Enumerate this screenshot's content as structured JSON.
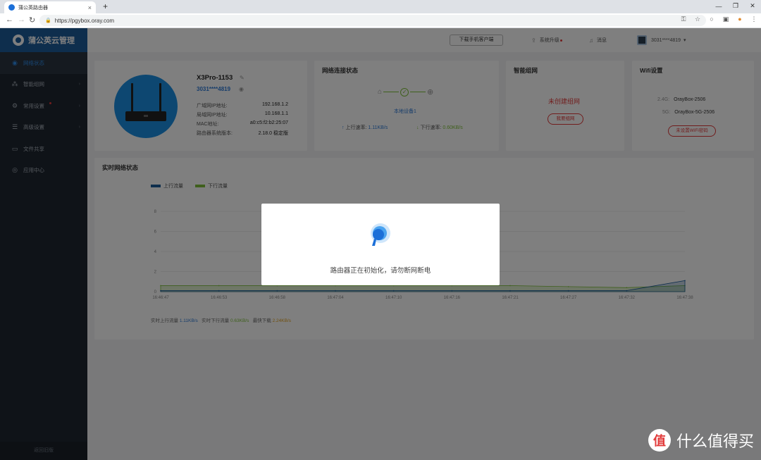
{
  "browser": {
    "tab_title": "蒲公英路由器",
    "new_tab": "+",
    "url": "https://pgybox.oray.com"
  },
  "sidebar": {
    "brand": "蒲公英云管理",
    "items": [
      {
        "label": "网络状态",
        "icon": "globe-icon",
        "active": true,
        "has_arrow": false
      },
      {
        "label": "智能组网",
        "icon": "network-icon",
        "active": false,
        "has_arrow": true
      },
      {
        "label": "常用设置",
        "icon": "gear-icon",
        "active": false,
        "has_arrow": true
      },
      {
        "label": "高级设置",
        "icon": "sliders-icon",
        "active": false,
        "has_arrow": true
      },
      {
        "label": "文件共享",
        "icon": "folder-icon",
        "active": false,
        "has_arrow": false
      },
      {
        "label": "应用中心",
        "icon": "apps-icon",
        "active": false,
        "has_arrow": false
      }
    ],
    "bottom": "返回旧版"
  },
  "topbar": {
    "download_btn": "下载手机客户端",
    "upgrade": "系统升级",
    "message": "消息",
    "account": "3031****4819"
  },
  "device": {
    "name": "X3Pro-1153",
    "id": "3031****4819",
    "rows": [
      {
        "label": "广域网IP地址:",
        "value": "192.168.1.2"
      },
      {
        "label": "局域网IP地址:",
        "value": "10.168.1.1"
      },
      {
        "label": "MAC地址:",
        "value": "a0:c5:f2:b2:25:07"
      },
      {
        "label": "路由器系统版本:",
        "value": "2.18.0 稳定版"
      }
    ]
  },
  "network": {
    "title": "网络连接状态",
    "device_link": "本地设备1",
    "up_label": "上行速率:",
    "up_value": "1.11KB/s",
    "down_label": "下行速率:",
    "down_value": "0.60KB/s"
  },
  "smart": {
    "title": "智能组网",
    "status": "未创建组网",
    "button": "我要组网"
  },
  "wifi": {
    "title": "Wifi设置",
    "band1_label": "2.4G:",
    "band1_ssid": "OrayBox-2506",
    "band2_label": "5G:",
    "band2_ssid": "OrayBox-5G-2506",
    "button": "未设置WiFi密码"
  },
  "chart_section": {
    "title": "实时网络状态",
    "foot_up_label": "实时上行流量",
    "foot_up_value": "1.11KB/s",
    "foot_down_label": "实时下行流量",
    "foot_down_value": "0.63KB/s",
    "foot_max_label": "最快下载",
    "foot_max_value": "2.24KB/s"
  },
  "chart_data": {
    "type": "area",
    "title": "实时网络状态",
    "series": [
      {
        "name": "上行流量",
        "color": "#1c5c9a",
        "values": [
          0.1,
          0.1,
          0.1,
          0.1,
          0.1,
          0.1,
          0.1,
          0.1,
          0.1,
          1.1
        ]
      },
      {
        "name": "下行流量",
        "color": "#7ec03a",
        "values": [
          0.6,
          0.6,
          0.6,
          0.6,
          0.6,
          0.6,
          0.6,
          0.5,
          0.4,
          0.6
        ]
      }
    ],
    "x": [
      "16:46:47",
      "16:46:53",
      "16:46:58",
      "16:47:04",
      "16:47:10",
      "16:47:16",
      "16:47:21",
      "16:47:27",
      "16:47:32",
      "16:47:38"
    ],
    "y_ticks": [
      0,
      2,
      4,
      6,
      8
    ],
    "ylim": [
      0,
      8
    ],
    "legend_position": "top-left",
    "grid": true
  },
  "modal": {
    "message": "路由器正在初始化，请勿断网断电"
  },
  "watermark": {
    "text": "什么值得买",
    "logo_glyph": "值"
  }
}
